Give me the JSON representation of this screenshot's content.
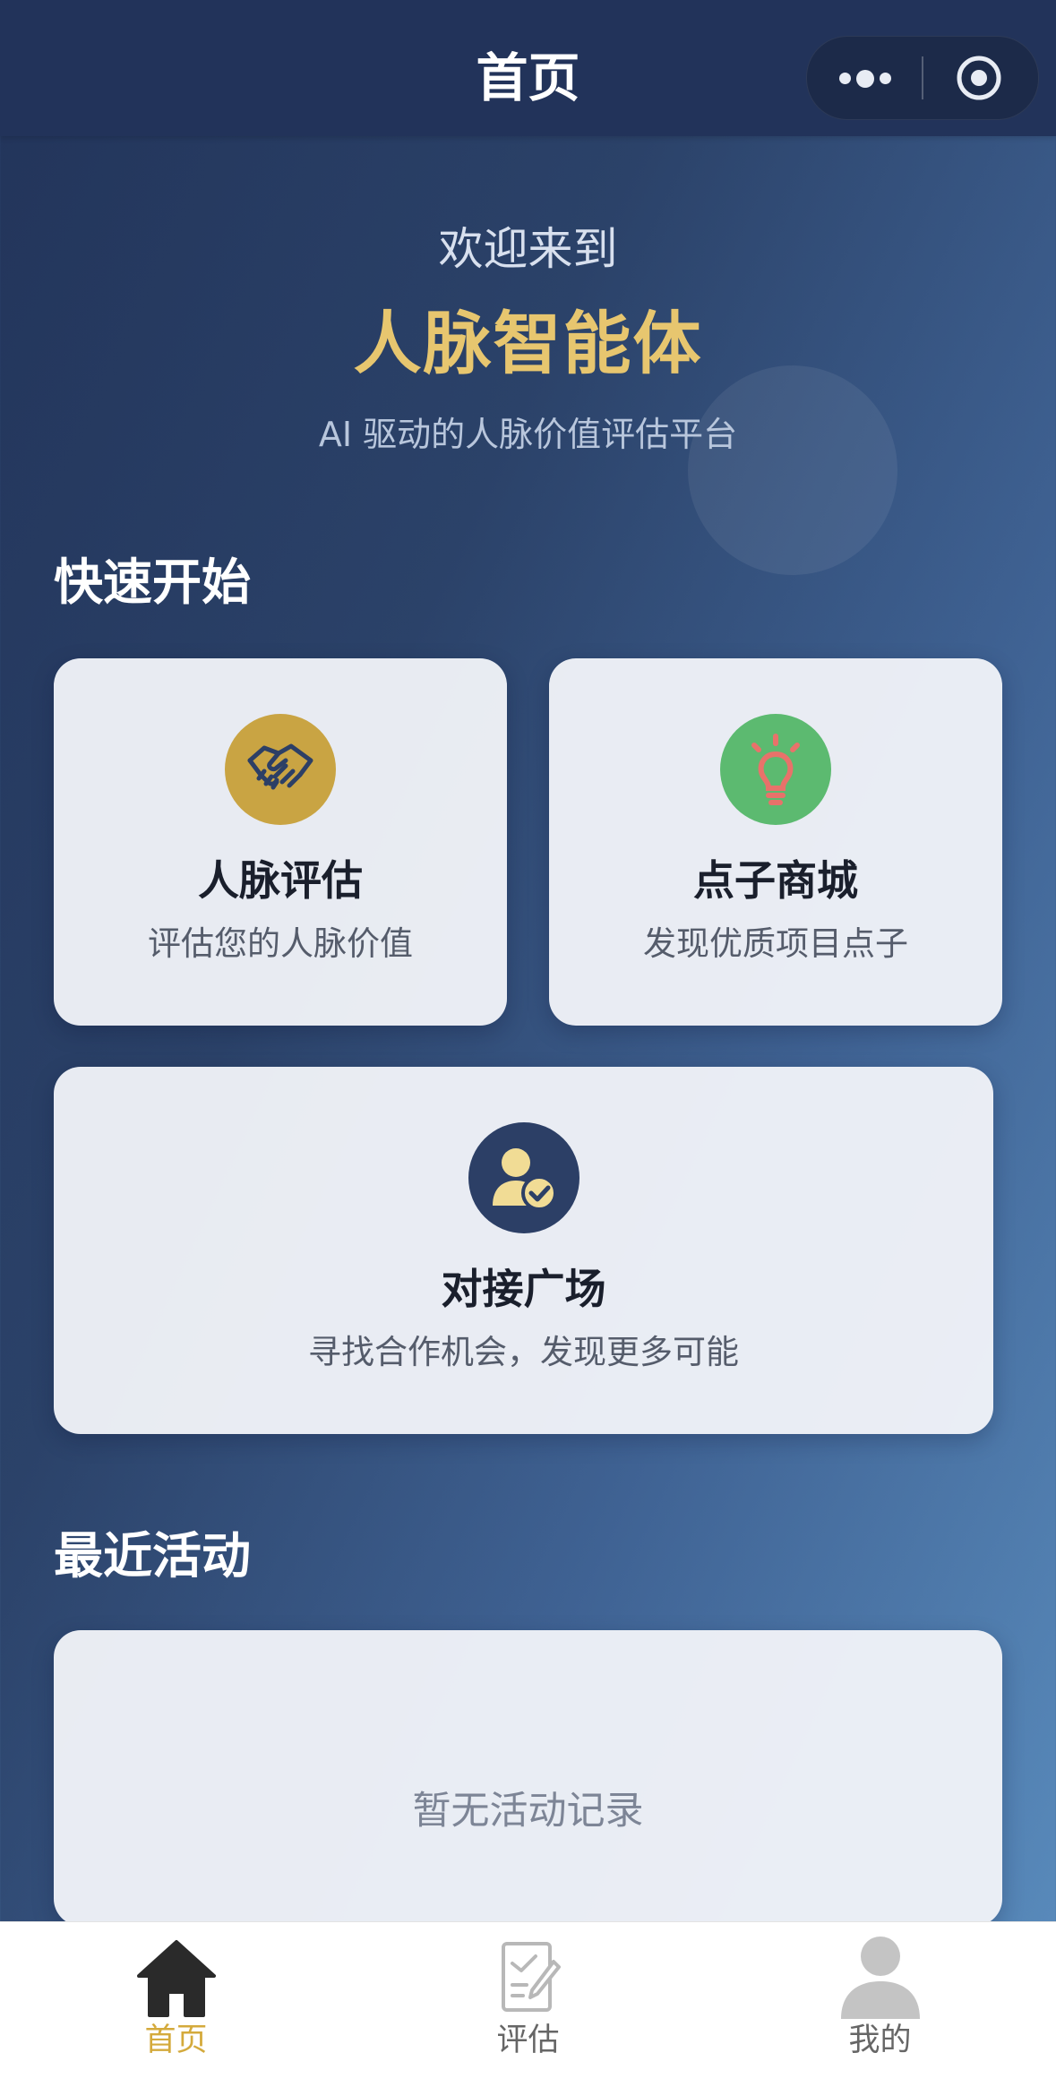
{
  "navbar": {
    "title": "首页"
  },
  "hero": {
    "welcome": "欢迎来到",
    "app_name": "人脉智能体",
    "tagline": "AI 驱动的人脉价值评估平台"
  },
  "quick_start": {
    "title": "快速开始",
    "cards": [
      {
        "icon": "handshake-icon",
        "title": "人脉评估",
        "desc": "评估您的人脉价值",
        "icon_bg": "#c9a443"
      },
      {
        "icon": "lightbulb-icon",
        "title": "点子商城",
        "desc": "发现优质项目点子",
        "icon_bg": "#5cba70"
      },
      {
        "icon": "user-check-icon",
        "title": "对接广场",
        "desc": "寻找合作机会，发现更多可能",
        "icon_bg": "#2c3f66"
      }
    ]
  },
  "recent": {
    "title": "最近活动",
    "empty_text": "暂无活动记录"
  },
  "tabbar": {
    "items": [
      {
        "label": "首页",
        "icon": "home-icon",
        "active": true
      },
      {
        "label": "评估",
        "icon": "edit-document-icon",
        "active": false
      },
      {
        "label": "我的",
        "icon": "user-icon",
        "active": false
      }
    ]
  },
  "colors": {
    "accent": "#d4aa3c",
    "title_gold": "#e7c66f",
    "nav_bg": "#22335a"
  }
}
